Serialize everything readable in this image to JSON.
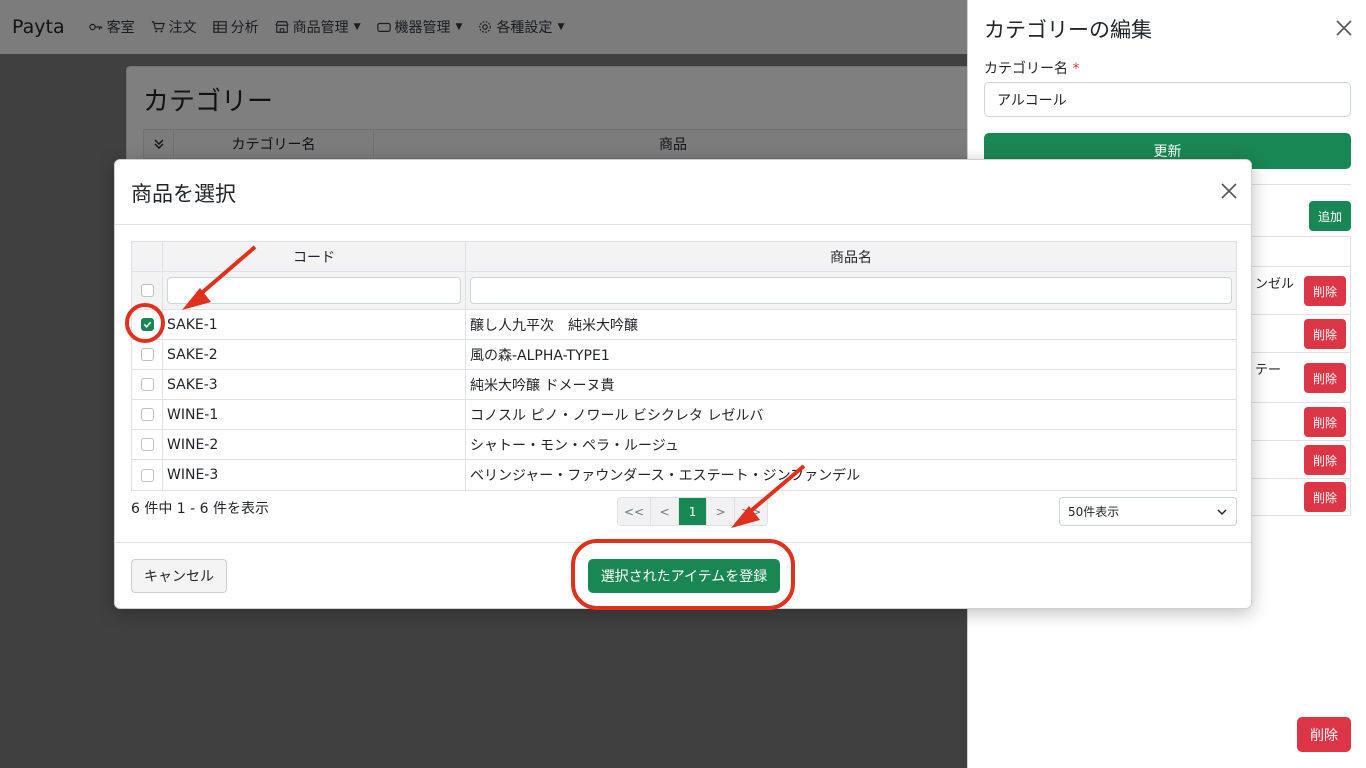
{
  "navbar": {
    "brand": "Payta",
    "items": [
      {
        "label": "客室",
        "icon": "key-icon"
      },
      {
        "label": "注文",
        "icon": "cart-icon"
      },
      {
        "label": "分析",
        "icon": "table-icon"
      },
      {
        "label": "商品管理",
        "icon": "shop-icon",
        "dropdown": true
      },
      {
        "label": "機器管理",
        "icon": "device-icon",
        "dropdown": true
      },
      {
        "label": "各種設定",
        "icon": "gear-icon",
        "dropdown": true
      }
    ]
  },
  "page": {
    "title": "カテゴリー",
    "columns": [
      "カテゴリー名",
      "商品"
    ]
  },
  "offcanvas": {
    "title": "カテゴリーの編集",
    "name_label": "カテゴリー名",
    "required_mark": "*",
    "name_value": "アルコール",
    "update_label": "更新",
    "add_label": "追加",
    "rows": [
      {
        "name": "ンゼル",
        "delete_label": "削除"
      },
      {
        "name": "",
        "delete_label": "削除"
      },
      {
        "name": "テー",
        "delete_label": "削除"
      },
      {
        "name": "",
        "delete_label": "削除"
      },
      {
        "name": "",
        "delete_label": "削除"
      },
      {
        "name": "",
        "delete_label": "削除"
      }
    ],
    "delete_label": "削除"
  },
  "modal": {
    "title": "商品を選択",
    "columns": {
      "code": "コード",
      "name": "商品名"
    },
    "rows": [
      {
        "code": "SAKE-1",
        "name": "醸し人九平次　純米大吟醸",
        "checked": true
      },
      {
        "code": "SAKE-2",
        "name": "風の森-ALPHA-TYPE1",
        "checked": false
      },
      {
        "code": "SAKE-3",
        "name": "純米大吟醸 ドメーヌ貴",
        "checked": false
      },
      {
        "code": "WINE-1",
        "name": "コノスル ピノ・ノワール ビシクレタ レゼルバ",
        "checked": false
      },
      {
        "code": "WINE-2",
        "name": "シャトー・モン・ペラ・ルージュ",
        "checked": false
      },
      {
        "code": "WINE-3",
        "name": "ベリンジャー・ファウンダース・エステート・ジンファンデル",
        "checked": false
      }
    ],
    "summary": "6 件中 1 - 6 件を表示",
    "pager": {
      "first": "<<",
      "prev": "<",
      "current": "1",
      "next": ">",
      "last": ">>"
    },
    "page_size": "50件表示",
    "cancel_label": "キャンセル",
    "register_label": "選択されたアイテムを登録"
  },
  "colors": {
    "primary": "#198754",
    "danger": "#dc3545",
    "annotation": "#e0301e"
  }
}
